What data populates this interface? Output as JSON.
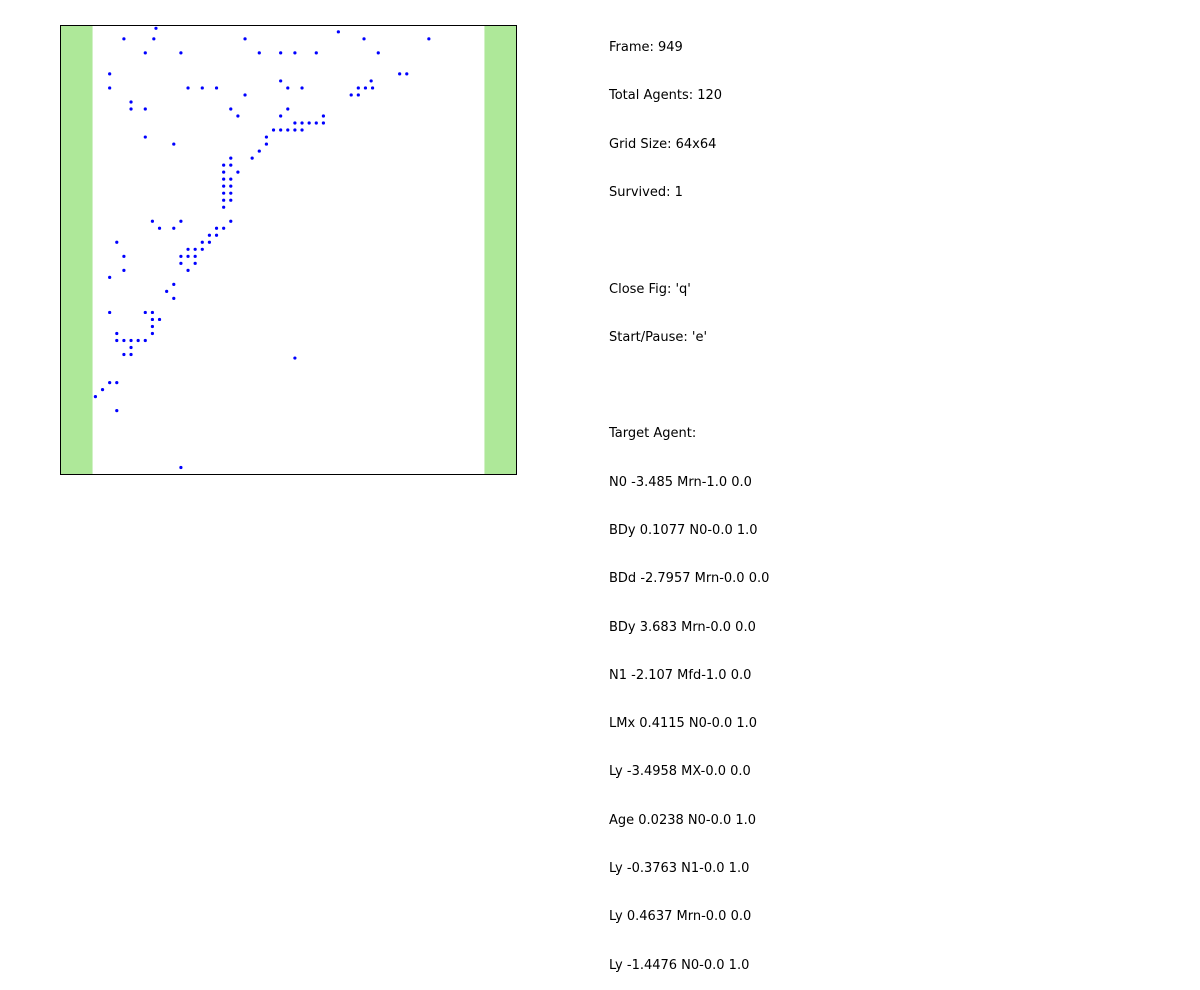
{
  "info": {
    "frame": "Frame: 949",
    "total_agents": "Total Agents: 120",
    "grid_size": "Grid Size: 64x64",
    "survived": "Survived: 1",
    "close_fig": "Close Fig: 'q'",
    "start_pause": "Start/Pause: 'e'",
    "target_agent_heading": "Target Agent:",
    "genome": [
      "N0 -3.485 Mrn-1.0 0.0",
      "BDy 0.1077 N0-0.0 1.0",
      "BDd -2.7957 Mrn-0.0 0.0",
      "BDy 3.683 Mrn-0.0 0.0",
      "N1 -2.107 Mfd-1.0 0.0",
      "LMx 0.4115 N0-0.0 1.0",
      "Ly -3.4958 MX-0.0 0.0",
      "Age 0.0238 N0-0.0 1.0",
      "Ly -0.3763 N1-0.0 1.0",
      "Ly 0.4637 Mrn-0.0 0.0",
      "Ly -1.4476 N0-0.0 1.0"
    ]
  },
  "colors": {
    "safe_zone": "#aee899",
    "agent": "#0000ff",
    "frame_border": "#000000",
    "grid_background": "#ffffff"
  },
  "chart_data": {
    "type": "scatter",
    "title": "",
    "xlabel": "",
    "ylabel": "",
    "xlim": [
      0,
      64
    ],
    "ylim": [
      0,
      64
    ],
    "grid": false,
    "safe_zones": [
      {
        "x_start": 0,
        "x_end": 4.5
      },
      {
        "x_start": 59.5,
        "x_end": 64
      }
    ],
    "series": [
      {
        "color": "#0000ff",
        "points": [
          [
            13.4,
            63.6
          ],
          [
            8.9,
            62.1
          ],
          [
            13.1,
            62.1
          ],
          [
            25.9,
            62.1
          ],
          [
            42.6,
            62.1
          ],
          [
            39.0,
            63.1
          ],
          [
            51.7,
            62.1
          ],
          [
            11.9,
            60.1
          ],
          [
            16.9,
            60.1
          ],
          [
            27.9,
            60.1
          ],
          [
            30.9,
            60.1
          ],
          [
            32.9,
            60.1
          ],
          [
            35.9,
            60.1
          ],
          [
            44.6,
            60.1
          ],
          [
            6.9,
            57.1
          ],
          [
            47.6,
            57.1
          ],
          [
            48.6,
            57.1
          ],
          [
            6.9,
            55.1
          ],
          [
            17.9,
            55.1
          ],
          [
            19.9,
            55.1
          ],
          [
            21.9,
            55.1
          ],
          [
            30.9,
            56.1
          ],
          [
            31.9,
            55.1
          ],
          [
            33.9,
            55.1
          ],
          [
            43.6,
            56.1
          ],
          [
            40.8,
            54.1
          ],
          [
            41.8,
            54.1
          ],
          [
            41.8,
            55.1
          ],
          [
            42.8,
            55.1
          ],
          [
            43.8,
            55.1
          ],
          [
            25.9,
            54.1
          ],
          [
            9.9,
            53.1
          ],
          [
            9.9,
            52.1
          ],
          [
            11.9,
            52.1
          ],
          [
            23.9,
            52.1
          ],
          [
            24.9,
            51.1
          ],
          [
            31.9,
            52.1
          ],
          [
            30.9,
            51.1
          ],
          [
            36.9,
            51.1
          ],
          [
            29.9,
            49.1
          ],
          [
            30.9,
            49.1
          ],
          [
            31.9,
            49.1
          ],
          [
            32.9,
            49.1
          ],
          [
            33.9,
            49.1
          ],
          [
            34.9,
            50.1
          ],
          [
            35.9,
            50.1
          ],
          [
            36.9,
            50.1
          ],
          [
            32.9,
            50.1
          ],
          [
            33.9,
            50.1
          ],
          [
            11.9,
            48.1
          ],
          [
            28.9,
            48.1
          ],
          [
            28.9,
            47.1
          ],
          [
            15.9,
            47.1
          ],
          [
            27.9,
            46.1
          ],
          [
            26.9,
            45.1
          ],
          [
            23.9,
            44.1
          ],
          [
            23.9,
            45.1
          ],
          [
            22.9,
            43.1
          ],
          [
            22.9,
            44.1
          ],
          [
            24.9,
            43.1
          ],
          [
            23.9,
            42.1
          ],
          [
            22.9,
            42.1
          ],
          [
            23.9,
            41.1
          ],
          [
            22.9,
            41.1
          ],
          [
            23.9,
            40.1
          ],
          [
            22.9,
            40.1
          ],
          [
            22.9,
            39.1
          ],
          [
            23.9,
            39.1
          ],
          [
            22.9,
            38.1
          ],
          [
            23.9,
            36.1
          ],
          [
            22.9,
            35.1
          ],
          [
            21.9,
            35.1
          ],
          [
            20.9,
            34.1
          ],
          [
            21.9,
            34.1
          ],
          [
            19.9,
            33.1
          ],
          [
            20.9,
            33.1
          ],
          [
            19.9,
            32.1
          ],
          [
            18.9,
            32.1
          ],
          [
            17.9,
            32.1
          ],
          [
            16.9,
            31.1
          ],
          [
            17.9,
            31.1
          ],
          [
            18.9,
            31.1
          ],
          [
            18.9,
            30.1
          ],
          [
            17.9,
            29.1
          ],
          [
            16.9,
            30.1
          ],
          [
            12.9,
            36.1
          ],
          [
            13.9,
            35.1
          ],
          [
            15.9,
            35.1
          ],
          [
            16.9,
            36.1
          ],
          [
            7.9,
            33.1
          ],
          [
            8.9,
            31.1
          ],
          [
            8.9,
            29.1
          ],
          [
            6.9,
            28.1
          ],
          [
            15.9,
            27.1
          ],
          [
            14.9,
            26.1
          ],
          [
            15.9,
            25.1
          ],
          [
            11.9,
            23.1
          ],
          [
            12.9,
            23.1
          ],
          [
            12.9,
            22.1
          ],
          [
            13.9,
            22.1
          ],
          [
            12.9,
            21.1
          ],
          [
            12.9,
            20.1
          ],
          [
            11.9,
            19.1
          ],
          [
            10.9,
            19.1
          ],
          [
            9.9,
            19.1
          ],
          [
            8.9,
            19.1
          ],
          [
            7.9,
            19.1
          ],
          [
            7.9,
            20.1
          ],
          [
            9.9,
            18.1
          ],
          [
            9.9,
            17.1
          ],
          [
            8.9,
            17.1
          ],
          [
            6.9,
            23.1
          ],
          [
            7.9,
            13.1
          ],
          [
            6.9,
            13.1
          ],
          [
            5.9,
            12.1
          ],
          [
            4.9,
            11.1
          ],
          [
            7.9,
            9.1
          ],
          [
            16.9,
            1.0
          ],
          [
            32.9,
            16.6
          ]
        ]
      }
    ]
  }
}
